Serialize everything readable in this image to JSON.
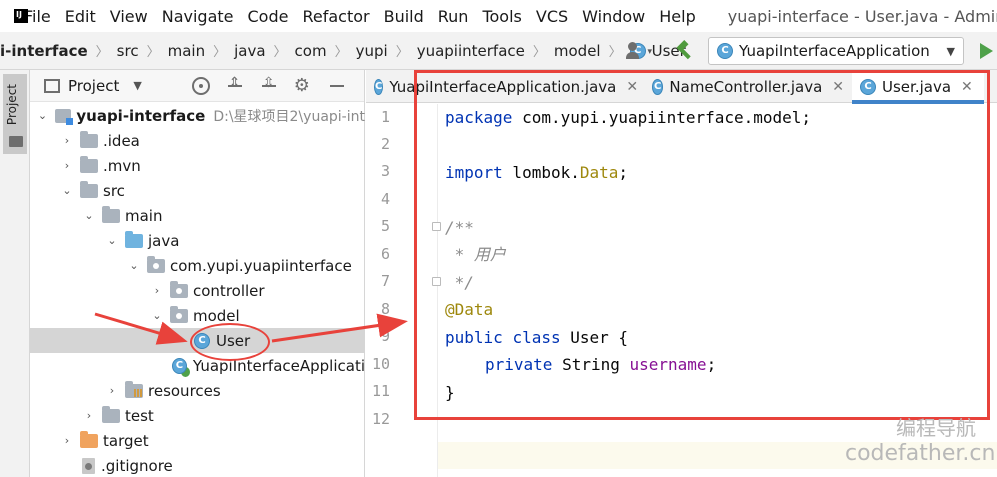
{
  "menubar": {
    "logo_letters": "IJ",
    "items": [
      "File",
      "Edit",
      "View",
      "Navigate",
      "Code",
      "Refactor",
      "Build",
      "Run",
      "Tools",
      "VCS",
      "Window",
      "Help"
    ],
    "window_title": "yuapi-interface - User.java - Adminis"
  },
  "navbar": {
    "crumbs": [
      "i-interface",
      "src",
      "main",
      "java",
      "com",
      "yupi",
      "yuapiinterface",
      "model",
      "User"
    ],
    "class_badge": "C",
    "run_config": "YuapiInterfaceApplication",
    "icons": [
      "user-icon",
      "hammer-icon",
      "run-icon"
    ]
  },
  "left_strip": {
    "label": "Project"
  },
  "project_panel": {
    "title": "Project",
    "tree": [
      {
        "label": "yuapi-interface",
        "hint": "D:\\星球项目2\\yuapi-int",
        "type": "module"
      },
      {
        "label": ".idea",
        "type": "folder"
      },
      {
        "label": ".mvn",
        "type": "folder"
      },
      {
        "label": "src",
        "type": "folder"
      },
      {
        "label": "main",
        "type": "folder"
      },
      {
        "label": "java",
        "type": "folder-blue"
      },
      {
        "label": "com.yupi.yuapiinterface",
        "type": "package"
      },
      {
        "label": "controller",
        "type": "package"
      },
      {
        "label": "model",
        "type": "package"
      },
      {
        "label": "User",
        "type": "class"
      },
      {
        "label": "YuapiInterfaceApplicati",
        "type": "app-class"
      },
      {
        "label": "resources",
        "type": "resources"
      },
      {
        "label": "test",
        "type": "folder"
      },
      {
        "label": "target",
        "type": "folder-orange"
      },
      {
        "label": ".gitignore",
        "type": "file"
      }
    ]
  },
  "editor": {
    "tabs": [
      {
        "label": "YuapiInterfaceApplication.java",
        "close": "✕"
      },
      {
        "label": "NameController.java",
        "close": "✕"
      },
      {
        "label": "User.java",
        "close": "✕"
      }
    ],
    "line_numbers": [
      "1",
      "2",
      "3",
      "4",
      "5",
      "6",
      "7",
      "8",
      "9",
      "10",
      "11",
      "12"
    ],
    "code": {
      "l1_kw": "package",
      "l1_rest": " com.yupi.yuapiinterface.model;",
      "l3_kw": "import",
      "l3_mid": " lombok.",
      "l3_ann": "Data",
      "l3_end": ";",
      "l5": "/**",
      "l6": " * 用户",
      "l7": " */",
      "l8": "@Data",
      "l9_kw1": "public",
      "l9_kw2": "class",
      "l9_rest": " User {",
      "l10_kw": "private",
      "l10_type": " String ",
      "l10_fld": "username",
      "l10_end": ";",
      "l11": "}"
    }
  },
  "watermark": {
    "line1": "编程导航",
    "line2": "codefather.cn"
  },
  "colors": {
    "annotation_red": "#e8423b",
    "keyword": "#0033b3",
    "annotation": "#9e880d",
    "field": "#871094",
    "comment": "#8c8c8c"
  }
}
